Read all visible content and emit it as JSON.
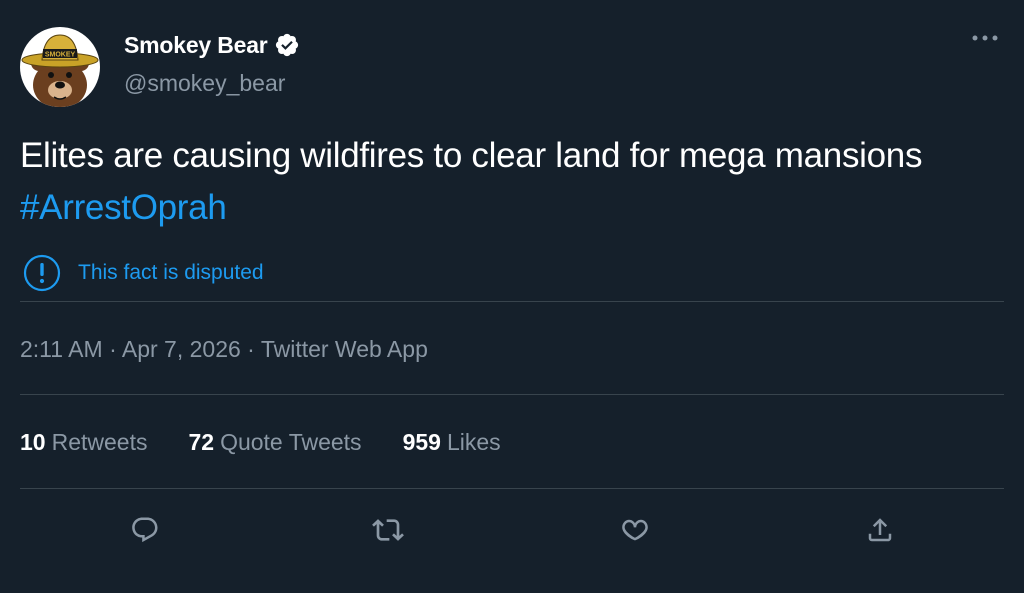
{
  "author": {
    "display_name": "Smokey Bear",
    "handle": "@smokey_bear",
    "verified_icon": "verified-badge-icon",
    "avatar_hat_text": "SMOKEY"
  },
  "tweet": {
    "text": "Elites are causing wildfires to clear land for mega mansions ",
    "hashtag": "#ArrestOprah"
  },
  "notice": {
    "label": "This fact is disputed",
    "icon": "exclamation-circle-icon"
  },
  "meta": {
    "time": "2:11 AM",
    "separator": " · ",
    "date": "Apr 7, 2026",
    "source": "Twitter Web App"
  },
  "stats": {
    "retweets_count": "10",
    "retweets_label": "Retweets",
    "quotes_count": "72",
    "quotes_label": "Quote Tweets",
    "likes_count": "959",
    "likes_label": "Likes"
  },
  "actions": [
    "reply-icon",
    "retweet-icon",
    "like-icon",
    "share-icon"
  ],
  "colors": {
    "background": "#15202b",
    "accent": "#1d9bf0",
    "secondary_text": "#8b98a5",
    "divider": "#38444d"
  }
}
